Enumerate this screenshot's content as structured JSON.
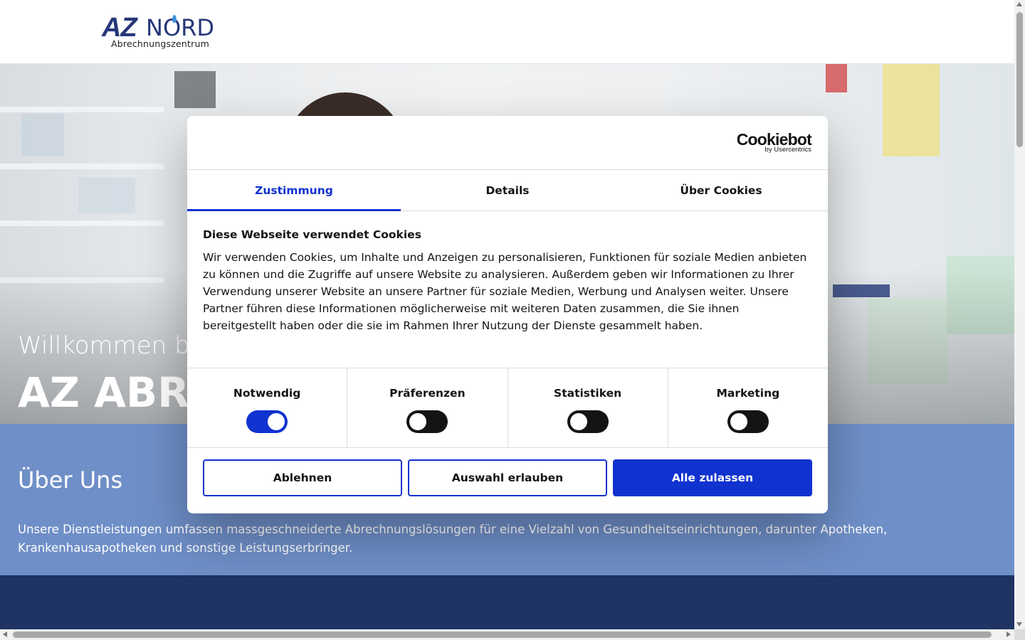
{
  "header": {
    "logo_az": "AZ",
    "logo_nord": "NORD",
    "logo_sub": "Abrechnungszentrum"
  },
  "hero": {
    "welcome": "Willkommen be",
    "title": "AZ ABRE"
  },
  "about": {
    "title": "Über Uns",
    "text": "Unsere Dienstleistungen umfassen massgeschneiderte Abrechnungslösungen für eine Vielzahl von Gesundheitseinrichtungen, darunter Apotheken, Krankenhausapotheken und sonstige Leistungserbringer."
  },
  "cookie_dialog": {
    "brand": "Cookiebot",
    "brand_by": "by Usercentrics",
    "tabs": [
      {
        "label": "Zustimmung",
        "active": true
      },
      {
        "label": "Details",
        "active": false
      },
      {
        "label": "Über Cookies",
        "active": false
      }
    ],
    "title": "Diese Webseite verwendet Cookies",
    "text": "Wir verwenden Cookies, um Inhalte und Anzeigen zu personalisieren, Funktionen für soziale Medien anbieten zu können und die Zugriffe auf unsere Website zu analysieren. Außerdem geben wir Informationen zu Ihrer Verwendung unserer Website an unsere Partner für soziale Medien, Werbung und Analysen weiter. Unsere Partner führen diese Informationen möglicherweise mit weiteren Daten zusammen, die Sie ihnen bereitgestellt haben oder die sie im Rahmen Ihrer Nutzung der Dienste gesammelt haben.",
    "categories": [
      {
        "label": "Notwendig",
        "enabled": true
      },
      {
        "label": "Präferenzen",
        "enabled": false
      },
      {
        "label": "Statistiken",
        "enabled": false
      },
      {
        "label": "Marketing",
        "enabled": false
      }
    ],
    "buttons": {
      "reject": "Ablehnen",
      "allow_selection": "Auswahl erlauben",
      "allow_all": "Alle zulassen"
    },
    "accent_color": "#1032cf"
  }
}
